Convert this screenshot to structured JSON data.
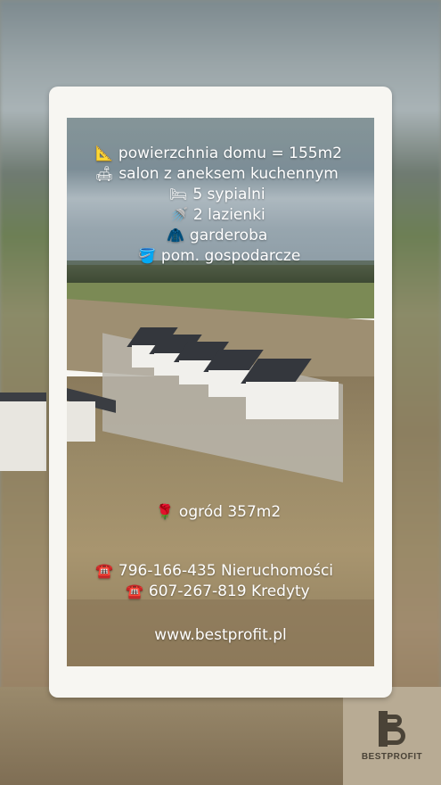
{
  "features": [
    {
      "icon": "📐",
      "icon_name": "triangle-ruler-icon",
      "text": "powierzchnia domu = 155m2"
    },
    {
      "icon": "🛋",
      "icon_name": "sofa-icon",
      "text": "salon z aneksem kuchennym"
    },
    {
      "icon": "🛏",
      "icon_name": "bed-icon",
      "text": "5 sypialni"
    },
    {
      "icon": "🚿",
      "icon_name": "shower-icon",
      "text": "2 lazienki"
    },
    {
      "icon": "🧥",
      "icon_name": "coat-icon",
      "text": "garderoba"
    },
    {
      "icon": "🪣",
      "icon_name": "bucket-icon",
      "text": "pom. gospodarcze"
    }
  ],
  "garden": {
    "icon": "🌹",
    "icon_name": "rose-icon",
    "text": "ogród 357m2"
  },
  "contacts": [
    {
      "icon": "☎️",
      "icon_name": "telephone-icon",
      "text": "796-166-435 Nieruchomości"
    },
    {
      "icon": "☎️",
      "icon_name": "telephone-icon",
      "text": "607-267-819 Kredyty"
    }
  ],
  "website": "www.bestprofit.pl",
  "brand": {
    "name": "BESTPROFIT"
  },
  "colors": {
    "text": "#ffffff",
    "card": "#f7f6f2",
    "brand": "#4a4337"
  }
}
